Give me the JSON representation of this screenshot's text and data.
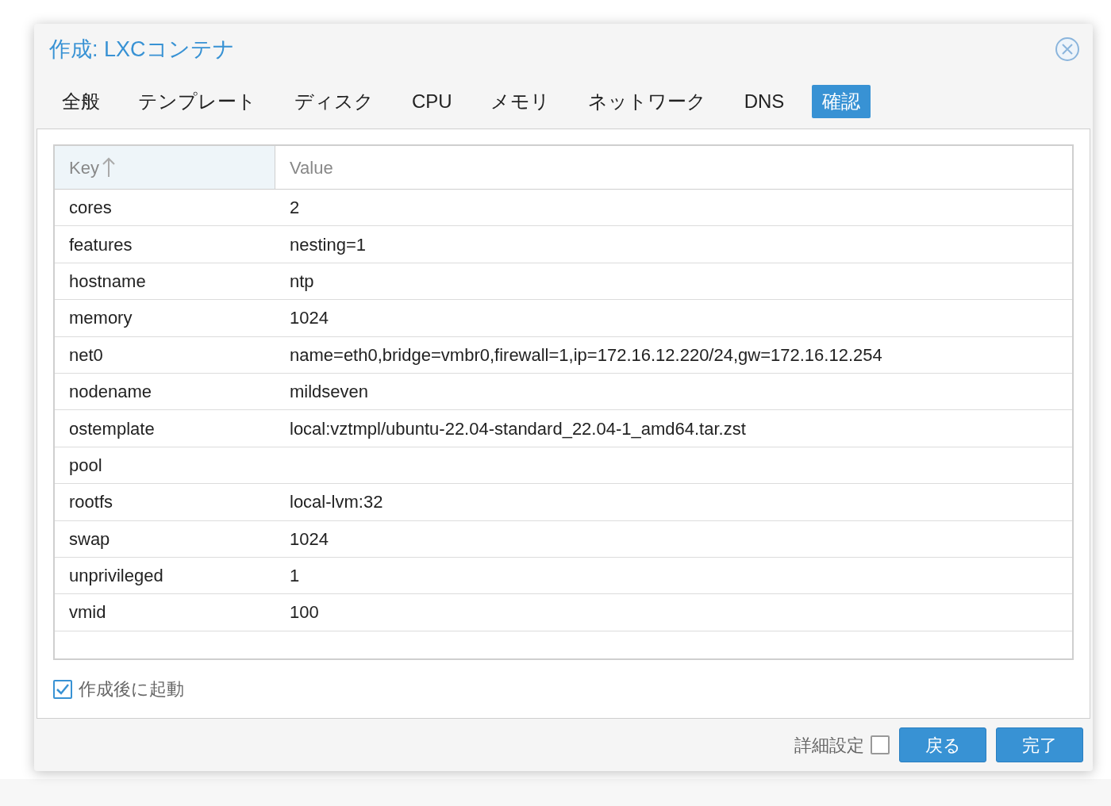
{
  "dialog": {
    "title": "作成: LXCコンテナ"
  },
  "tabs": [
    {
      "label": "全般",
      "selected": false
    },
    {
      "label": "テンプレート",
      "selected": false
    },
    {
      "label": "ディスク",
      "selected": false
    },
    {
      "label": "CPU",
      "selected": false
    },
    {
      "label": "メモリ",
      "selected": false
    },
    {
      "label": "ネットワーク",
      "selected": false
    },
    {
      "label": "DNS",
      "selected": false
    },
    {
      "label": "確認",
      "selected": true
    }
  ],
  "table": {
    "columns": [
      {
        "label": "Key",
        "sorted": true
      },
      {
        "label": "Value",
        "sorted": false
      }
    ],
    "rows": [
      {
        "key": "cores",
        "value": "2"
      },
      {
        "key": "features",
        "value": "nesting=1"
      },
      {
        "key": "hostname",
        "value": "ntp"
      },
      {
        "key": "memory",
        "value": "1024"
      },
      {
        "key": "net0",
        "value": "name=eth0,bridge=vmbr0,firewall=1,ip=172.16.12.220/24,gw=172.16.12.254"
      },
      {
        "key": "nodename",
        "value": "mildseven"
      },
      {
        "key": "ostemplate",
        "value": "local:vztmpl/ubuntu-22.04-standard_22.04-1_amd64.tar.zst"
      },
      {
        "key": "pool",
        "value": ""
      },
      {
        "key": "rootfs",
        "value": "local-lvm:32"
      },
      {
        "key": "swap",
        "value": "1024"
      },
      {
        "key": "unprivileged",
        "value": "1"
      },
      {
        "key": "vmid",
        "value": "100"
      }
    ]
  },
  "start_after_create": {
    "label": "作成後に起動",
    "checked": true
  },
  "footer": {
    "advanced": {
      "label": "詳細設定",
      "checked": false
    },
    "buttons": [
      "戻る",
      "完了"
    ]
  }
}
